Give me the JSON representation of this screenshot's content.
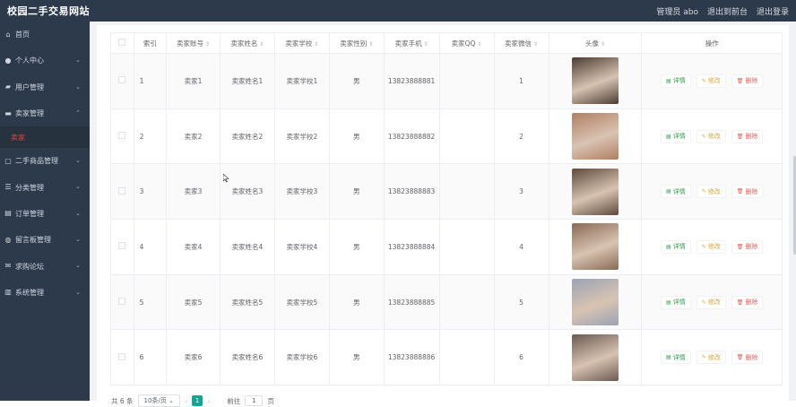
{
  "app": {
    "title": "校园二手交易网站"
  },
  "topbar": {
    "admin": "管理员 abo",
    "backend": "退出到前台",
    "logout": "退出登录"
  },
  "sidebar": {
    "items": [
      {
        "label": "首页",
        "icon": "home-icon",
        "has_children": false
      },
      {
        "label": "个人中心",
        "icon": "user-icon",
        "has_children": true
      },
      {
        "label": "用户管理",
        "icon": "users-icon",
        "has_children": true
      },
      {
        "label": "卖家管理",
        "icon": "seller-icon",
        "has_children": true,
        "expanded": true,
        "sub": [
          "卖家"
        ]
      },
      {
        "label": "二手商品管理",
        "icon": "goods-icon",
        "has_children": true
      },
      {
        "label": "分类管理",
        "icon": "category-icon",
        "has_children": true
      },
      {
        "label": "订单管理",
        "icon": "order-icon",
        "has_children": true
      },
      {
        "label": "留言板管理",
        "icon": "message-icon",
        "has_children": true
      },
      {
        "label": "求购论坛",
        "icon": "forum-icon",
        "has_children": true
      },
      {
        "label": "系统管理",
        "icon": "system-icon",
        "has_children": true
      }
    ]
  },
  "table": {
    "columns": [
      "索引",
      "卖家账号",
      "卖家姓名",
      "卖家学校",
      "卖家性别",
      "卖家手机",
      "卖家QQ",
      "卖家微信",
      "头像",
      "操作"
    ],
    "sortable": [
      false,
      true,
      true,
      true,
      true,
      true,
      true,
      true,
      true,
      false
    ],
    "rows": [
      {
        "index": "1",
        "account": "卖家1",
        "name": "卖家姓名1",
        "school": "卖家学校1",
        "gender": "男",
        "phone": "13823888881",
        "qq": "",
        "wechat": "1",
        "photo_color": "#4a3b32"
      },
      {
        "index": "2",
        "account": "卖家2",
        "name": "卖家姓名2",
        "school": "卖家学校2",
        "gender": "男",
        "phone": "13823888882",
        "qq": "",
        "wechat": "2",
        "photo_color": "#b07f63"
      },
      {
        "index": "3",
        "account": "卖家3",
        "name": "卖家姓名3",
        "school": "卖家学校3",
        "gender": "男",
        "phone": "13823888883",
        "qq": "",
        "wechat": "3",
        "photo_color": "#5d4a3a"
      },
      {
        "index": "4",
        "account": "卖家4",
        "name": "卖家姓名4",
        "school": "卖家学校4",
        "gender": "男",
        "phone": "13823888884",
        "qq": "",
        "wechat": "4",
        "photo_color": "#8a6a55"
      },
      {
        "index": "5",
        "account": "卖家5",
        "name": "卖家姓名5",
        "school": "卖家学校5",
        "gender": "男",
        "phone": "13823888885",
        "qq": "",
        "wechat": "5",
        "photo_color": "#9aa3b4"
      },
      {
        "index": "6",
        "account": "卖家6",
        "name": "卖家姓名6",
        "school": "卖家学校6",
        "gender": "男",
        "phone": "13823888886",
        "qq": "",
        "wechat": "6",
        "photo_color": "#6b5a52"
      }
    ],
    "actions": {
      "detail": "详情",
      "edit": "修改",
      "delete": "删除"
    }
  },
  "pagination": {
    "total": "共 6 条",
    "page_size": "10条/页",
    "current": "1",
    "goto_label": "前往",
    "goto_value": "1",
    "page_unit": "页"
  },
  "colors": {
    "sidebar_bg": "#2d3a4b",
    "active_sub": "#e0463a",
    "page_active": "#12a594"
  }
}
